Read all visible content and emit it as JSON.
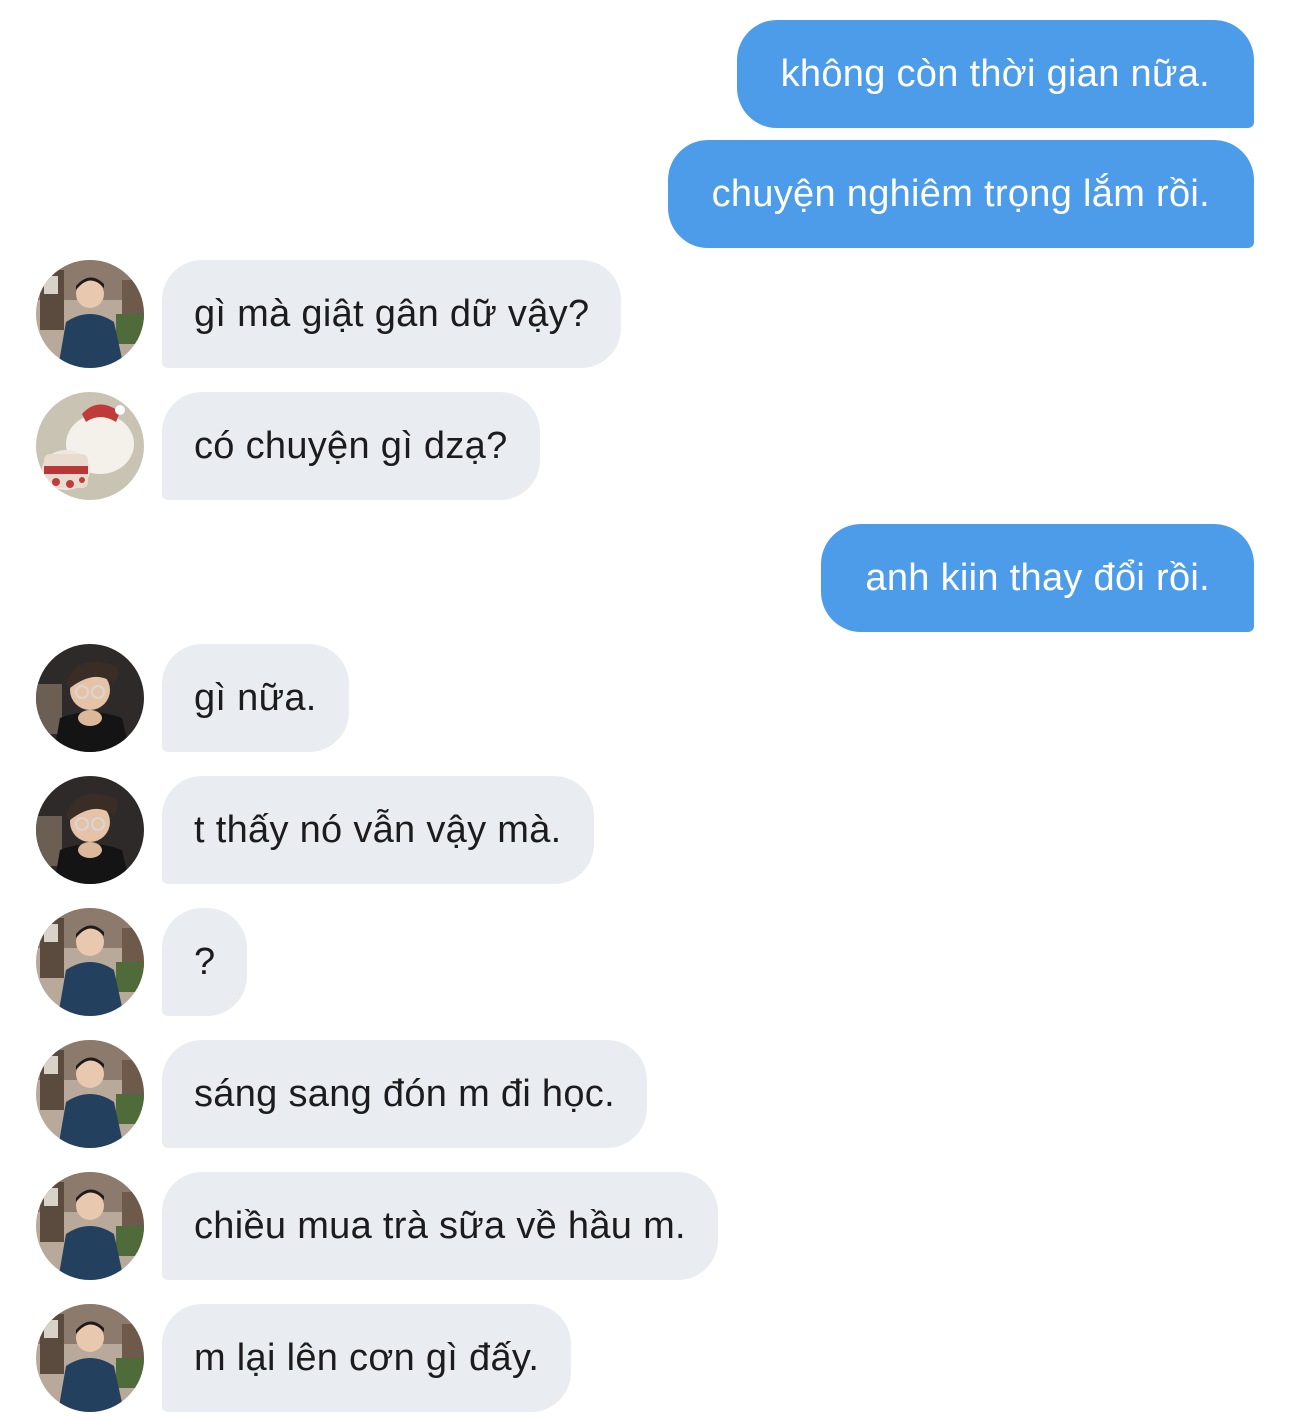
{
  "messages": [
    {
      "direction": "out",
      "text": "không còn thời gian nữa."
    },
    {
      "direction": "out",
      "text": "chuyện nghiêm trọng lắm rồi."
    },
    {
      "direction": "in",
      "avatar": "boy-street-avatar-icon",
      "text": "gì mà giật gân dữ vậy?"
    },
    {
      "direction": "in",
      "avatar": "cartoon-bear-avatar-icon",
      "text": "có chuyện gì dzạ?"
    },
    {
      "direction": "out",
      "text": "anh kiin thay đổi rồi."
    },
    {
      "direction": "in",
      "avatar": "boy-glasses-avatar-icon",
      "text": "gì nữa."
    },
    {
      "direction": "in",
      "avatar": "boy-glasses-avatar-icon",
      "text": "t thấy nó vẫn vậy mà."
    },
    {
      "direction": "in",
      "avatar": "boy-street-avatar-icon",
      "text": "?"
    },
    {
      "direction": "in",
      "avatar": "boy-street-avatar-icon",
      "text": "sáng sang đón m đi học."
    },
    {
      "direction": "in",
      "avatar": "boy-street-avatar-icon",
      "text": "chiều mua trà sữa về hầu m."
    },
    {
      "direction": "in",
      "avatar": "boy-street-avatar-icon",
      "text": "m lại lên cơn gì đấy."
    }
  ],
  "colors": {
    "outgoing_bubble": "#4d9ce9",
    "incoming_bubble": "#e9ecf1",
    "outgoing_text": "#ffffff",
    "incoming_text": "#1c1c1e",
    "background": "#ffffff"
  }
}
